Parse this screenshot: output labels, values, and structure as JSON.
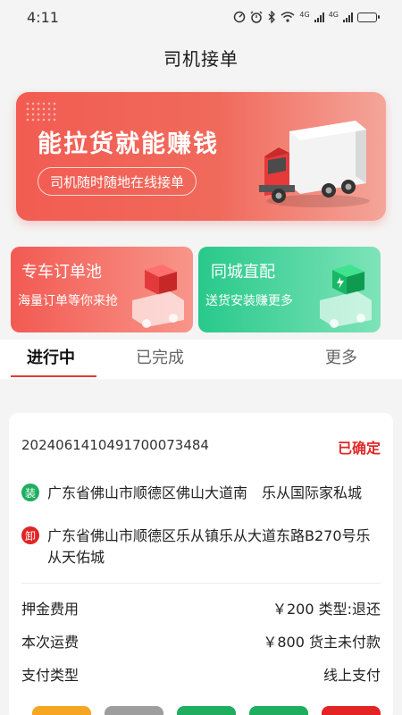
{
  "status_bar": {
    "time": "4:11",
    "net_label_1": "4G",
    "net_label_2": "4G",
    "battery_level": 0.55
  },
  "header": {
    "title": "司机接单"
  },
  "banner": {
    "title": "能拉货就能赚钱",
    "subtitle": "司机随时随地在线接单"
  },
  "cards": [
    {
      "title": "专车订单池",
      "subtitle": "海量订单等你来抢"
    },
    {
      "title": "同城直配",
      "subtitle": "送货安装赚更多"
    }
  ],
  "tabs": [
    {
      "label": "进行中",
      "active": true
    },
    {
      "label": "已完成",
      "active": false
    },
    {
      "label": "更多",
      "active": false
    }
  ],
  "order": {
    "number": "20240614104917000​73484",
    "status": "已确定",
    "load": {
      "badge": "装",
      "address": "广东省佛山市顺德区佛山大道南　乐从国际家私城"
    },
    "unload": {
      "badge": "卸",
      "address": "广东省佛山市顺德区乐从镇乐从大道东路B270号乐从天佑城"
    },
    "rows": [
      {
        "label": "押金费用",
        "value": "￥200 类型:退还"
      },
      {
        "label": "本次运费",
        "value": "￥800 货主未付款"
      },
      {
        "label": "支付类型",
        "value": "线上支付"
      }
    ]
  },
  "colors": {
    "accent": "#e23a33",
    "red_card": "#f25a52",
    "green_card": "#28c98a",
    "button_orange": "#f5a623",
    "button_gray": "#9e9e9e",
    "button_green": "#1fae5f",
    "button_red": "#e22424"
  }
}
